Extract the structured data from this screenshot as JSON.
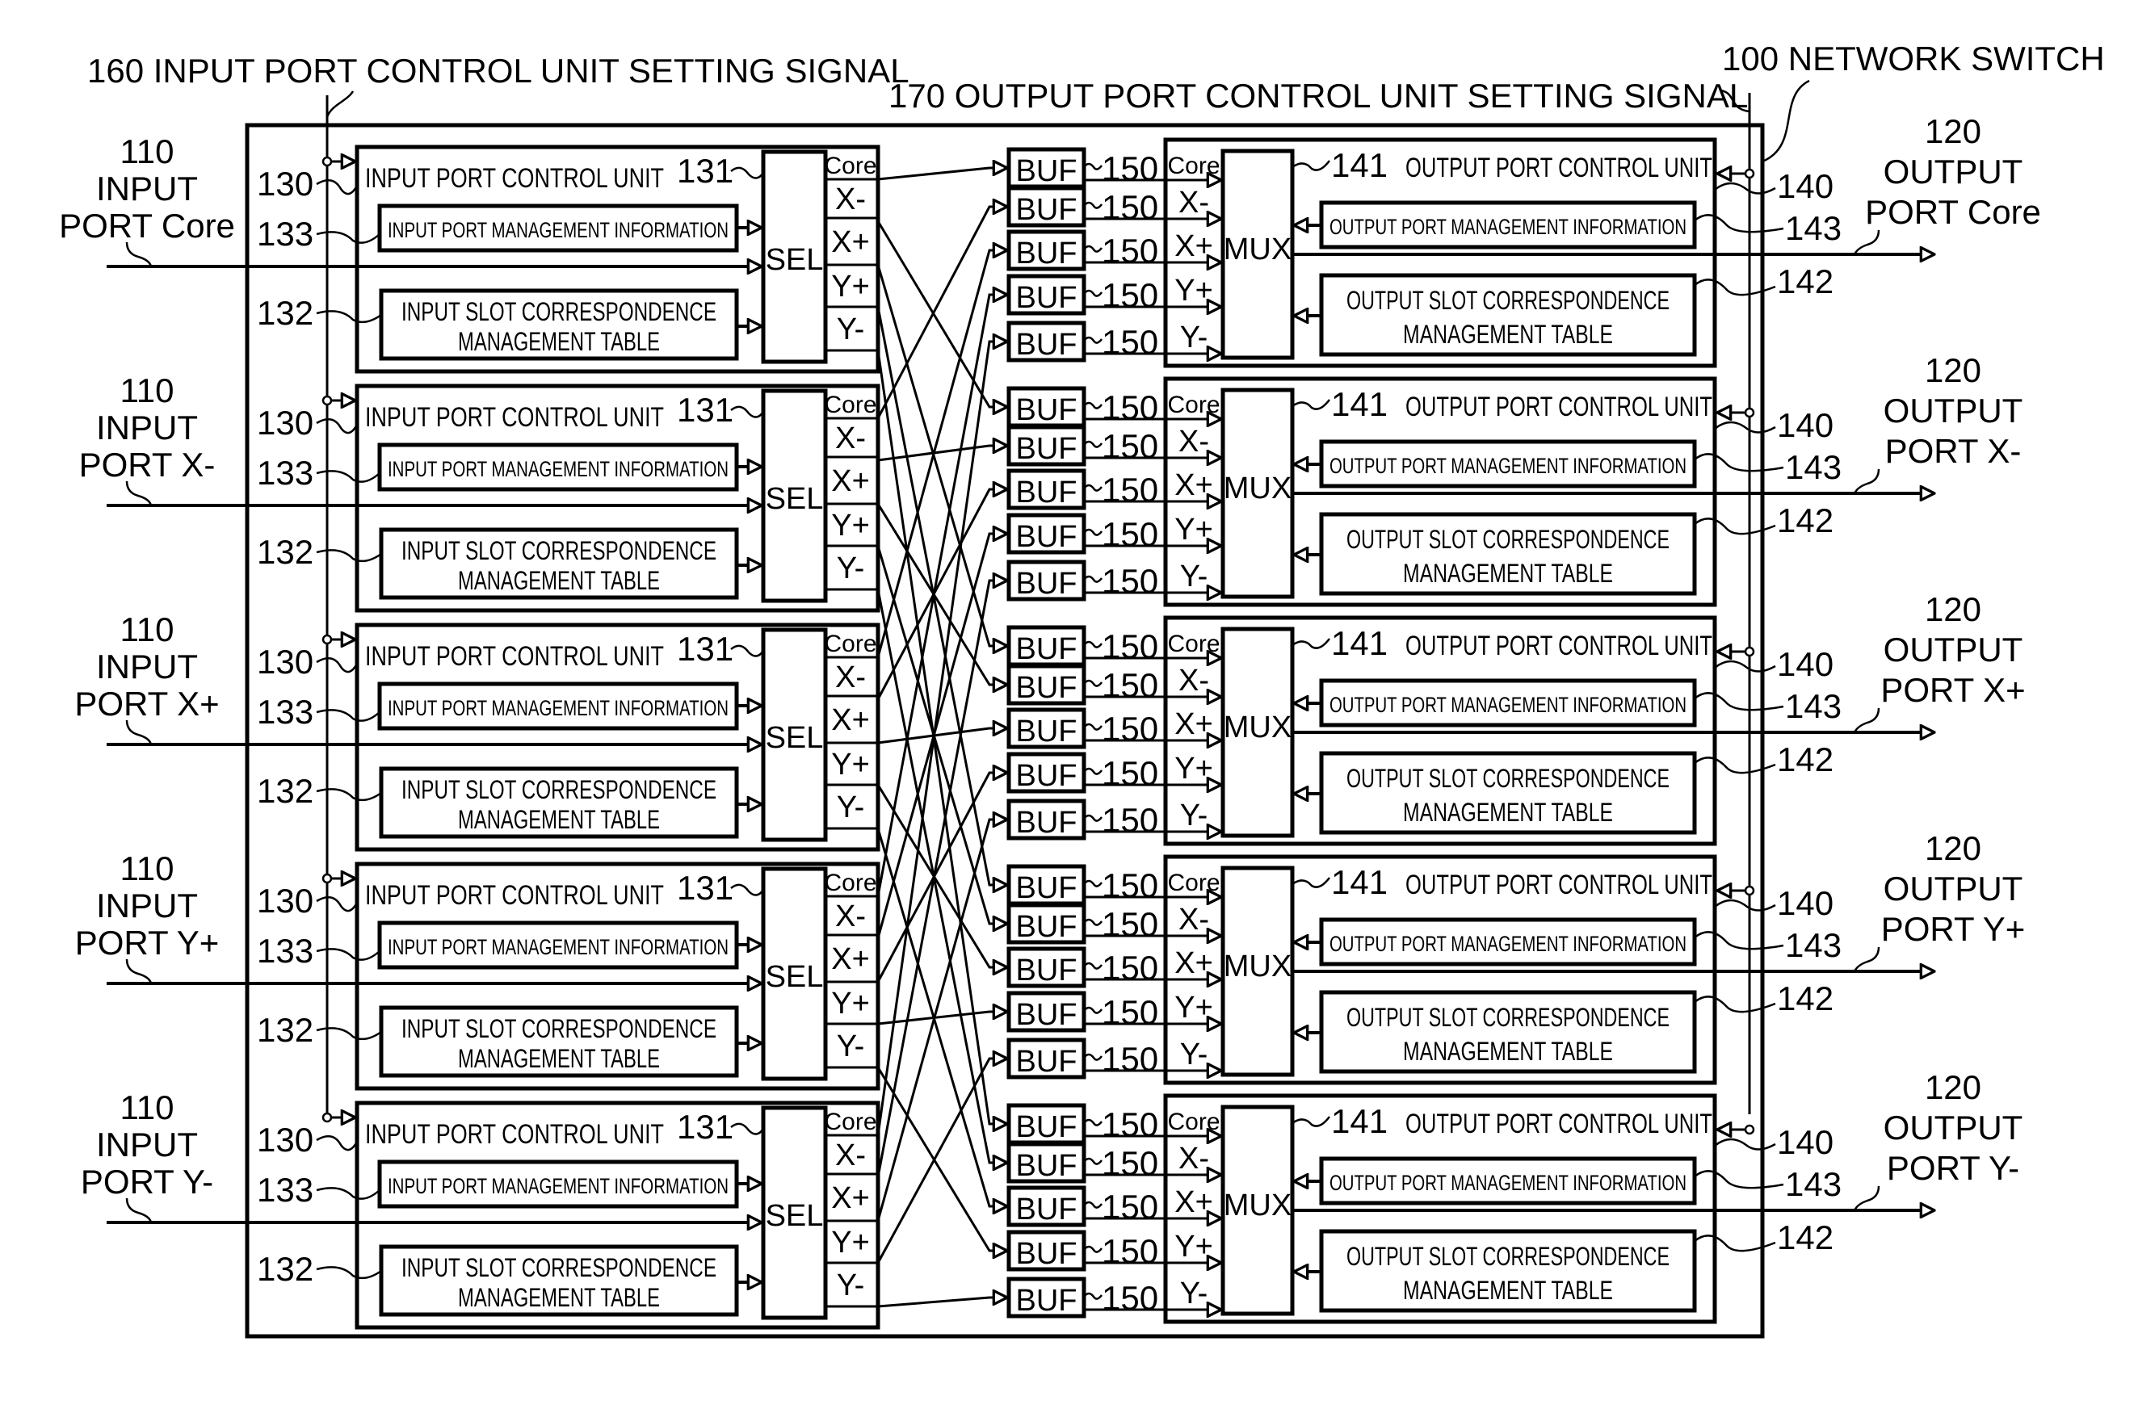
{
  "diagram": {
    "title": "100 NETWORK SWITCH",
    "input_bus_label": "160 INPUT PORT CONTROL UNIT SETTING SIGNAL",
    "output_bus_label": "170 OUTPUT PORT CONTROL UNIT SETTING SIGNAL",
    "ports": [
      "Core",
      "X-",
      "X+",
      "Y+",
      "Y-"
    ],
    "input_ports": [
      {
        "ref": "110",
        "line1": "INPUT",
        "line2": "PORT Core"
      },
      {
        "ref": "110",
        "line1": "INPUT",
        "line2": "PORT X-"
      },
      {
        "ref": "110",
        "line1": "INPUT",
        "line2": "PORT X+"
      },
      {
        "ref": "110",
        "line1": "INPUT",
        "line2": "PORT Y+"
      },
      {
        "ref": "110",
        "line1": "INPUT",
        "line2": "PORT Y-"
      }
    ],
    "output_ports": [
      {
        "ref": "120",
        "line1": "OUTPUT",
        "line2": "PORT Core"
      },
      {
        "ref": "120",
        "line1": "OUTPUT",
        "line2": "PORT X-"
      },
      {
        "ref": "120",
        "line1": "OUTPUT",
        "line2": "PORT X+"
      },
      {
        "ref": "120",
        "line1": "OUTPUT",
        "line2": "PORT Y+"
      },
      {
        "ref": "120",
        "line1": "OUTPUT",
        "line2": "PORT Y-"
      }
    ],
    "input_unit": {
      "ref_unit": "130",
      "ref_sel": "131",
      "ref_table": "132",
      "ref_info": "133",
      "title": "INPUT PORT CONTROL UNIT",
      "info_label": "INPUT PORT MANAGEMENT INFORMATION",
      "table_line1": "INPUT SLOT CORRESPONDENCE",
      "table_line2": "MANAGEMENT TABLE",
      "sel_label": "SEL"
    },
    "output_unit": {
      "ref_unit": "140",
      "ref_mux": "141",
      "ref_table": "142",
      "ref_info": "143",
      "title": "OUTPUT PORT CONTROL UNIT",
      "info_label": "OUTPUT PORT MANAGEMENT INFORMATION",
      "table_line1": "OUTPUT SLOT CORRESPONDENCE",
      "table_line2": "MANAGEMENT TABLE",
      "mux_label": "MUX"
    },
    "buffer": {
      "label": "BUF",
      "ref": "150"
    }
  }
}
